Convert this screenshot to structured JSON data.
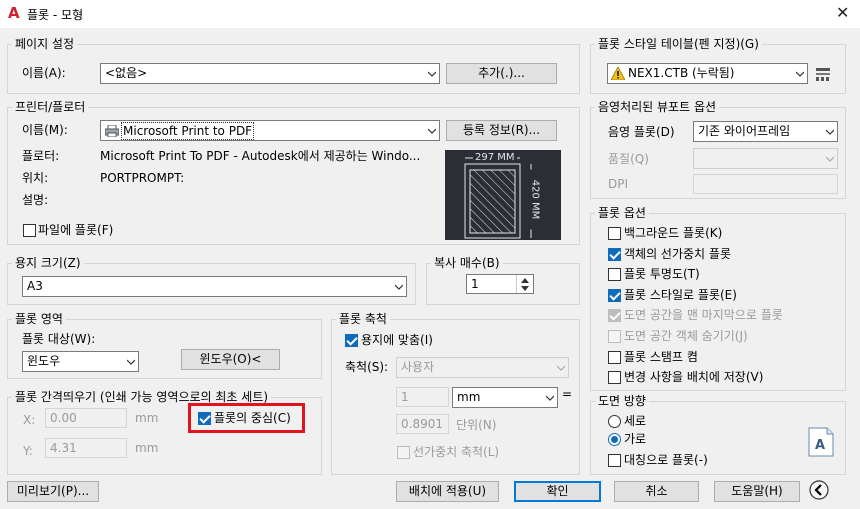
{
  "window": {
    "title": "플롯 - 모형"
  },
  "page_setup": {
    "group_title": "페이지 설정",
    "name_label": "이름(A):",
    "name_value": "<없음>",
    "add_button": "추가(.)..."
  },
  "printer": {
    "group_title": "프린터/플로터",
    "name_label": "이름(M):",
    "name_value": "Microsoft Print to PDF",
    "properties_button": "등록 정보(R)...",
    "plotter_label": "플로터:",
    "plotter_value": "Microsoft Print To PDF - Autodesk에서 제공하는 Windo...",
    "where_label": "위치:",
    "where_value": "PORTPROMPT:",
    "desc_label": "설명:",
    "plot_to_file_label": "파일에 플롯(F)",
    "plot_to_file_checked": false,
    "preview_width": "297 MM",
    "preview_height": "420 MM"
  },
  "paper_size": {
    "group_title": "용지 크기(Z)",
    "value": "A3"
  },
  "copies": {
    "group_title": "복사 매수(B)",
    "value": "1"
  },
  "plot_area": {
    "group_title": "플롯 영역",
    "what_label": "플롯 대상(W):",
    "what_value": "윈도우",
    "window_button": "윈도우(O)<"
  },
  "plot_offset": {
    "group_title": "플롯 간격띄우기 (인쇄 가능 영역으로의 최초 세트)",
    "x_label": "X:",
    "x_value": "0.00",
    "y_label": "Y:",
    "y_value": "4.31",
    "unit": "mm",
    "center_label": "플롯의 중심(C)",
    "center_checked": true,
    "highlight_color": "#e0141e"
  },
  "plot_scale": {
    "group_title": "플롯 축척",
    "fit_label": "용지에 맞춤(I)",
    "fit_checked": true,
    "scale_label": "축척(S):",
    "scale_value": "사용자",
    "value1": "1",
    "unit_value": "mm",
    "equals": "=",
    "value2": "0.8901",
    "units_label": "단위(N)",
    "lineweights_label": "선가중치 축척(L)",
    "lineweights_checked": false
  },
  "style_table": {
    "group_title": "플롯 스타일 테이블(펜 지정)(G)",
    "value": "NEX1.CTB (누락됨)"
  },
  "viewport": {
    "group_title": "음영처리된 뷰포트 옵션",
    "shade_label": "음영 플롯(D)",
    "shade_value": "기존 와이어프레임",
    "quality_label": "품질(Q)",
    "dpi_label": "DPI"
  },
  "plot_options": {
    "group_title": "플롯 옵션",
    "items": [
      {
        "label": "백그라운드 플롯(K)",
        "checked": false,
        "disabled": false
      },
      {
        "label": "객체의 선가중치 플롯",
        "checked": true,
        "disabled": false
      },
      {
        "label": "플롯 투명도(T)",
        "checked": false,
        "disabled": false
      },
      {
        "label": "플롯 스타일로 플롯(E)",
        "checked": true,
        "disabled": false
      },
      {
        "label": "도면 공간을 맨 마지막으로 플롯",
        "checked": true,
        "disabled": true
      },
      {
        "label": "도면 공간 객체 숨기기(J)",
        "checked": false,
        "disabled": true
      },
      {
        "label": "플롯 스탬프 켬",
        "checked": false,
        "disabled": false
      },
      {
        "label": "변경 사항을 배치에 저장(V)",
        "checked": false,
        "disabled": false
      }
    ]
  },
  "orientation": {
    "group_title": "도면 방향",
    "portrait_label": "세로",
    "landscape_label": "가로",
    "upside_down_label": "대칭으로 플롯(-)",
    "selected": "landscape",
    "upside_down_checked": false
  },
  "footer": {
    "preview_button": "미리보기(P)...",
    "apply_button": "배치에 적용(U)",
    "ok_button": "확인",
    "cancel_button": "취소",
    "help_button": "도움말(H)"
  }
}
